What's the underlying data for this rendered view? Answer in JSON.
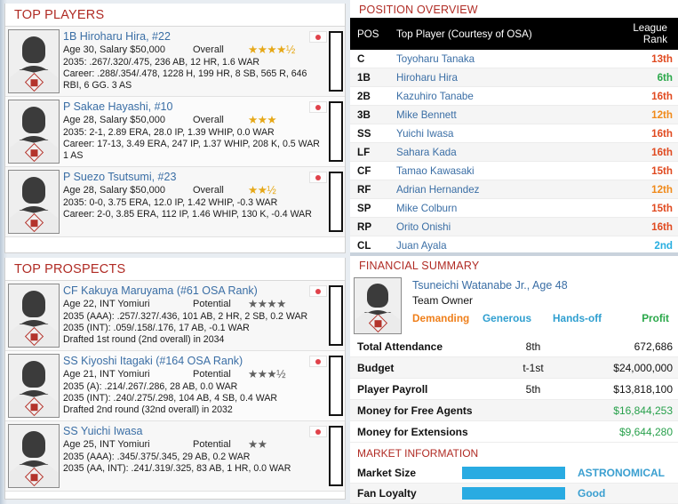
{
  "left": {
    "top_players": {
      "title": "TOP PLAYERS",
      "overall_label": "Overall",
      "players": [
        {
          "name": "1B Hiroharu Hira, #22",
          "age_salary": "Age 30, Salary $50,000",
          "stars": "★★★★½",
          "stats": "2035: .267/.320/.475, 236 AB, 12 HR, 1.6 WAR\nCareer: .288/.354/.478, 1228 H, 199 HR, 8 SB, 565 R, 646 RBI, 6 GG. 3 AS",
          "flag": "japan-flag-icon"
        },
        {
          "name": "P Sakae Hayashi, #10",
          "age_salary": "Age 28, Salary $50,000",
          "stars": "★★★",
          "stats": "2035: 2-1, 2.89 ERA, 28.0 IP, 1.39 WHIP, 0.0 WAR\nCareer: 17-13, 3.49 ERA, 247 IP, 1.37 WHIP, 208 K, 0.5 WAR\n1 AS",
          "flag": "japan-flag-icon"
        },
        {
          "name": "P Suezo Tsutsumi, #23",
          "age_salary": "Age 28, Salary $50,000",
          "stars": "★★½",
          "stats": "2035: 0-0, 3.75 ERA, 12.0 IP, 1.42 WHIP, -0.3 WAR\nCareer: 2-0, 3.85 ERA, 112 IP, 1.46 WHIP, 130 K, -0.4 WAR",
          "flag": "japan-flag-icon"
        }
      ]
    },
    "top_prospects": {
      "title": "TOP PROSPECTS",
      "potential_label": "Potential",
      "players": [
        {
          "name": "CF Kakuya Maruyama (#61 OSA Rank)",
          "age_salary": "Age 22, INT Yomiuri",
          "stars": "★★★★",
          "stats": "2035 (AAA): .257/.327/.436, 101 AB, 2 HR, 2 SB, 0.2 WAR\n2035 (INT): .059/.158/.176, 17 AB, -0.1 WAR\nDrafted 1st round (2nd overall) in 2034",
          "flag": "japan-flag-icon"
        },
        {
          "name": "SS Kiyoshi Itagaki (#164 OSA Rank)",
          "age_salary": "Age 21, INT Yomiuri",
          "stars": "★★★½",
          "stats": "2035 (A): .214/.267/.286, 28 AB, 0.0 WAR\n2035 (INT): .240/.275/.298, 104 AB, 4 SB, 0.4 WAR\nDrafted 2nd round (32nd overall) in 2032",
          "flag": "japan-flag-icon"
        },
        {
          "name": "SS Yuichi Iwasa",
          "age_salary": "Age 25, INT Yomiuri",
          "stars": "★★",
          "stats": "2035 (AAA): .345/.375/.345, 29 AB, 0.2 WAR\n2035 (AA, INT): .241/.319/.325, 83 AB, 1 HR, 0.0 WAR",
          "flag": "japan-flag-icon"
        }
      ]
    }
  },
  "right": {
    "position_overview": {
      "title": "POSITION OVERVIEW",
      "columns": [
        "POS",
        "Top Player (Courtesy of OSA)",
        "League Rank"
      ],
      "rows": [
        {
          "pos": "C",
          "player": "Toyoharu Tanaka",
          "rank": "13th",
          "rank_color": "#e04a20"
        },
        {
          "pos": "1B",
          "player": "Hiroharu Hira",
          "rank": "6th",
          "rank_color": "#2aa84a"
        },
        {
          "pos": "2B",
          "player": "Kazuhiro Tanabe",
          "rank": "16th",
          "rank_color": "#e04a20"
        },
        {
          "pos": "3B",
          "player": "Mike Bennett",
          "rank": "12th",
          "rank_color": "#f08a1a"
        },
        {
          "pos": "SS",
          "player": "Yuichi Iwasa",
          "rank": "16th",
          "rank_color": "#e04a20"
        },
        {
          "pos": "LF",
          "player": "Sahara Kada",
          "rank": "16th",
          "rank_color": "#e04a20"
        },
        {
          "pos": "CF",
          "player": "Tamao Kawasaki",
          "rank": "15th",
          "rank_color": "#e04a20"
        },
        {
          "pos": "RF",
          "player": "Adrian Hernandez",
          "rank": "12th",
          "rank_color": "#f08a1a"
        },
        {
          "pos": "SP",
          "player": "Mike Colburn",
          "rank": "15th",
          "rank_color": "#e04a20"
        },
        {
          "pos": "RP",
          "player": "Orito Onishi",
          "rank": "16th",
          "rank_color": "#e04a20"
        },
        {
          "pos": "CL",
          "player": "Juan Ayala",
          "rank": "2nd",
          "rank_color": "#27aee0"
        }
      ]
    },
    "financial_summary": {
      "title": "FINANCIAL SUMMARY",
      "owner": {
        "name": "Tsuneichi Watanabe Jr., Age 48",
        "role": "Team Owner",
        "traits": [
          {
            "label": "Demanding",
            "color": "#ef7f1a"
          },
          {
            "label": "Generous",
            "color": "#2f9fd0"
          },
          {
            "label": "Hands-off",
            "color": "#2f9fd0"
          },
          {
            "label": "Profit",
            "color": "#2aa84a"
          }
        ]
      },
      "rows": [
        {
          "label": "Total Attendance",
          "rank": "8th",
          "value": "672,686",
          "value_color": "#111111"
        },
        {
          "label": "Budget",
          "rank": "t-1st",
          "value": "$24,000,000",
          "value_color": "#111111"
        },
        {
          "label": "Player Payroll",
          "rank": "5th",
          "value": "$13,818,100",
          "value_color": "#111111"
        },
        {
          "label": "Money for Free Agents",
          "rank": "",
          "value": "$16,844,253",
          "value_color": "#27a04b"
        },
        {
          "label": "Money for Extensions",
          "rank": "",
          "value": "$9,644,280",
          "value_color": "#27a04b"
        }
      ],
      "market": {
        "title": "MARKET INFORMATION",
        "rows": [
          {
            "label": "Market Size",
            "value": "ASTRONOMICAL",
            "bar_pct": 100,
            "bar_color": "#29abe2"
          },
          {
            "label": "Fan Loyalty",
            "value": "Good",
            "bar_pct": 100,
            "bar_color": "#29abe2"
          }
        ]
      }
    }
  }
}
